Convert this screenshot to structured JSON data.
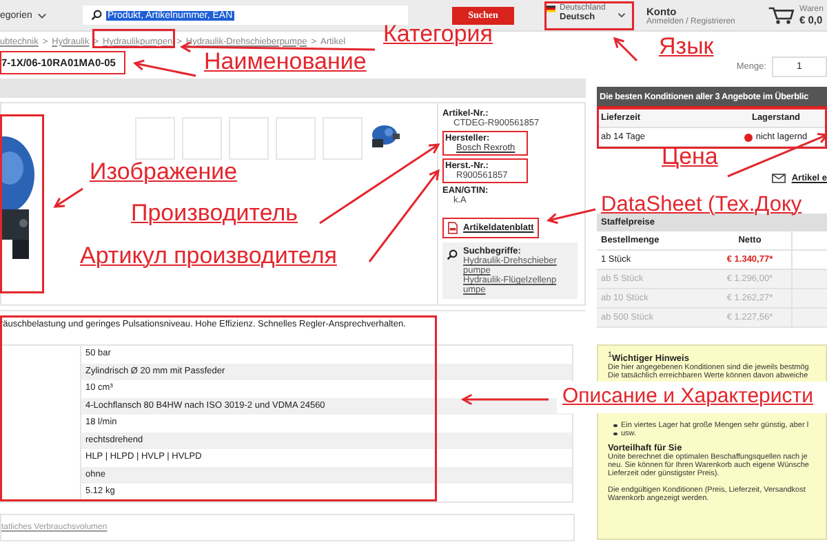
{
  "header": {
    "category_menu": "egorien",
    "search": {
      "value": "Produkt, Artikelnummer, EAN"
    },
    "search_button": "Suchen",
    "region": {
      "country": "Deutschland",
      "language": "Deutsch"
    },
    "account": {
      "title": "Konto",
      "links": "Anmelden / Registrieren"
    },
    "cart": {
      "label": "Waren",
      "total": "€ 0,0"
    }
  },
  "breadcrumb": {
    "separator": ">",
    "items": [
      "ubtechnik",
      "Hydraulik",
      "Hydraulikpumpen",
      "Hydraulik-Drehschieberpumpe",
      "Artikel"
    ]
  },
  "product": {
    "title": "7-1X/06-10RA01MA0-05",
    "details": [
      {
        "label": "Artikel-Nr.:",
        "value": "CTDEG-R900561857",
        "kind": "text"
      },
      {
        "label": "Hersteller:",
        "value": "Bosch Rexroth",
        "kind": "link"
      },
      {
        "label": "Herst.-Nr.:",
        "value": "R900561857",
        "kind": "text"
      },
      {
        "label": "EAN/GTIN:",
        "value": "k.A",
        "kind": "text"
      }
    ],
    "datasheet_link": "Artikeldatenblatt",
    "search_terms": {
      "label": "Suchbegriffe:",
      "links": [
        "Hydraulik-Drehschieberpumpe",
        "Hydraulik-Flügelzellenpumpe"
      ]
    },
    "description": "räuschbelastung und geringes Pulsationsniveau. Hohe Effizienz. Schnelles Regler-Ansprechverhalten.",
    "specs": [
      "50 bar",
      "Zylindrisch Ø 20 mm mit Passfeder",
      "10 cm³",
      "4-Lochflansch 80 B4HW nach ISO 3019-2 und VDMA 24560",
      "18 l/min",
      "rechtsdrehend",
      "HLP | HLPD | HVLP | HVLPD",
      "ohne",
      "5.12 kg"
    ],
    "footer_link": "tatliches Verbrauchsvolumen"
  },
  "quantity": {
    "label": "Menge:",
    "value": "1"
  },
  "best_offers": {
    "title": "Die besten Konditionen aller 3 Angebote im Überblic",
    "columns": [
      "Lieferzeit",
      "Lagerstand"
    ],
    "rows": [
      {
        "delivery": "ab 14 Tage",
        "stock": "nicht lagernd",
        "color": "#e02020"
      }
    ]
  },
  "article_link": "Artikel e",
  "tier_prices": {
    "title": "Staffelpreise",
    "columns": [
      "Bestellmenge",
      "Netto"
    ],
    "rows": [
      {
        "quantity": "1 Stück",
        "price": "€ 1.340,77*",
        "selected": true
      },
      {
        "quantity": "ab 5 Stück",
        "price": "€ 1.296,00*",
        "selected": false
      },
      {
        "quantity": "ab 10 Stück",
        "price": "€ 1.262,27*",
        "selected": false
      },
      {
        "quantity": "ab 500 Stück",
        "price": "€ 1.227,56*",
        "selected": false
      }
    ]
  },
  "notice": {
    "title": "$^{1}$**Wichtiger Hinweis**",
    "lines": [
      "Die hier angegebenen Konditionen sind die jeweils bestmög",
      "Die tatsächlich erreichbaren Werte können davon abweiche"
    ],
    "bullets": [
      "Ein viertes Lager hat große Mengen sehr günstig, aber l",
      "usw."
    ],
    "benefit_title": "Vorteilhaft für Sie",
    "benefit_lines": [
      "Unite berechnet die optimalen Beschaffungsquellen nach je",
      "neu. Sie können für Ihren Warenkorb auch eigene Wünsche",
      "Lieferzeit oder günstigster Preis)."
    ],
    "final_lines": [
      "Die endgültigen Konditionen (Preis, Lieferzeit, Versandkost",
      "Warenkorb angezeigt werden."
    ]
  },
  "annotations": [
    "Категория",
    "Наименование",
    "Язык",
    "Изображение",
    "Цена",
    "Производитель",
    "DataSheet (Тех.Доку",
    "Артикул производителя",
    "Описание и Характеристи"
  ]
}
